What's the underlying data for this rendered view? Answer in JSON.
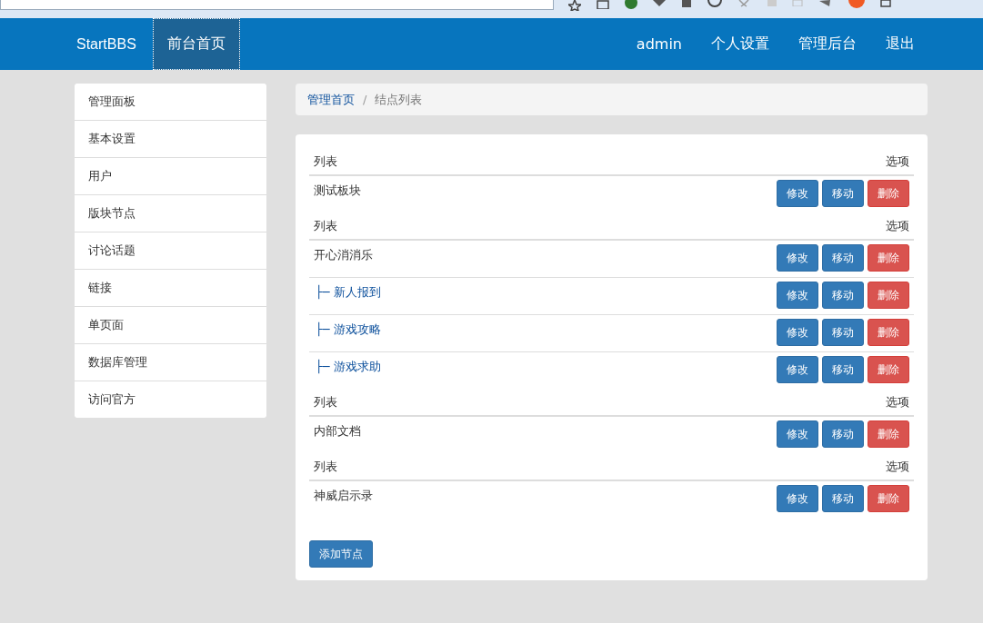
{
  "navbar": {
    "brand": "StartBBS",
    "left_items": [
      {
        "label": "前台首页",
        "selected": true
      }
    ],
    "right_items": [
      {
        "label": "admin"
      },
      {
        "label": "个人设置"
      },
      {
        "label": "管理后台"
      },
      {
        "label": "退出"
      }
    ]
  },
  "sidebar": {
    "items": [
      {
        "label": "管理面板"
      },
      {
        "label": "基本设置"
      },
      {
        "label": "用户"
      },
      {
        "label": "版块节点"
      },
      {
        "label": "讨论话题"
      },
      {
        "label": "链接"
      },
      {
        "label": "单页面"
      },
      {
        "label": "数据库管理"
      },
      {
        "label": "访问官方"
      }
    ]
  },
  "breadcrumb": [
    {
      "label": "管理首页",
      "kind": "link"
    },
    {
      "label": "/",
      "kind": "separator"
    },
    {
      "label": "结点列表",
      "kind": "current"
    }
  ],
  "groups": [
    {
      "header": [
        "列表",
        "选项"
      ],
      "rows": [
        {
          "name": "测试板块",
          "prefix": null,
          "actions": [
            {
              "label": "修改",
              "kind": "primary"
            },
            {
              "label": "移动",
              "kind": "primary"
            },
            {
              "label": "删除",
              "kind": "danger"
            }
          ]
        }
      ]
    },
    {
      "header": [
        "列表",
        "选项"
      ],
      "rows": [
        {
          "name": "开心消消乐",
          "prefix": null,
          "actions": [
            {
              "label": "修改",
              "kind": "primary"
            },
            {
              "label": "移动",
              "kind": "primary"
            },
            {
              "label": "删除",
              "kind": "danger"
            }
          ]
        },
        {
          "name": "新人报到",
          "prefix": "├─",
          "actions": [
            {
              "label": "修改",
              "kind": "primary"
            },
            {
              "label": "移动",
              "kind": "primary"
            },
            {
              "label": "删除",
              "kind": "danger"
            }
          ]
        },
        {
          "name": "游戏攻略",
          "prefix": "├─",
          "actions": [
            {
              "label": "修改",
              "kind": "primary"
            },
            {
              "label": "移动",
              "kind": "primary"
            },
            {
              "label": "删除",
              "kind": "danger"
            }
          ]
        },
        {
          "name": "游戏求助",
          "prefix": "├─",
          "actions": [
            {
              "label": "修改",
              "kind": "primary"
            },
            {
              "label": "移动",
              "kind": "primary"
            },
            {
              "label": "删除",
              "kind": "danger"
            }
          ]
        }
      ]
    },
    {
      "header": [
        "列表",
        "选项"
      ],
      "rows": [
        {
          "name": "内部文档",
          "prefix": null,
          "actions": [
            {
              "label": "修改",
              "kind": "primary"
            },
            {
              "label": "移动",
              "kind": "primary"
            },
            {
              "label": "删除",
              "kind": "danger"
            }
          ]
        }
      ]
    },
    {
      "header": [
        "列表",
        "选项"
      ],
      "rows": [
        {
          "name": "神威启示录",
          "prefix": null,
          "actions": [
            {
              "label": "修改",
              "kind": "primary"
            },
            {
              "label": "移动",
              "kind": "primary"
            },
            {
              "label": "删除",
              "kind": "danger"
            }
          ]
        }
      ]
    }
  ],
  "add_button": "添加节点"
}
